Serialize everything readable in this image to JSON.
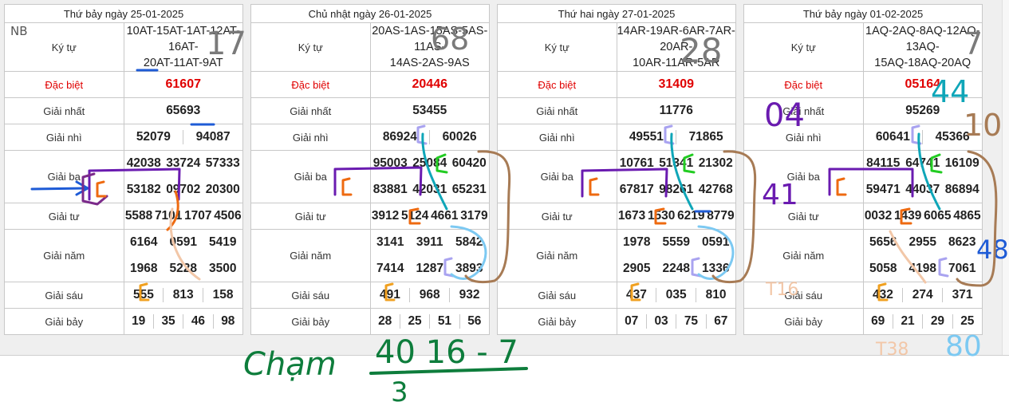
{
  "labels": {
    "kytu": "Ký tự",
    "db": "Đặc biệt",
    "g1": "Giải nhất",
    "g2": "Giải nhì",
    "g3": "Giải ba",
    "g4": "Giải tư",
    "g5": "Giải năm",
    "g6": "Giải sáu",
    "g7": "Giải bảy"
  },
  "tables": [
    {
      "date": "Thứ bảy ngày 25-01-2025",
      "kytu_line1": "10AT-15AT-1AT-12AT-16AT-",
      "kytu_line2": "20AT-11AT-9AT",
      "db": "61607",
      "g1": "65693",
      "g2": [
        "52079",
        "94087"
      ],
      "g3": [
        "42038",
        "33724",
        "57333",
        "53182",
        "09702",
        "20300"
      ],
      "g4": [
        "5588",
        "7101",
        "1707",
        "4506"
      ],
      "g5": [
        "6164",
        "0591",
        "5419",
        "1968",
        "5228",
        "3500"
      ],
      "g6": [
        "555",
        "813",
        "158"
      ],
      "g7": [
        "19",
        "35",
        "46",
        "98"
      ]
    },
    {
      "date": "Chủ nhật ngày 26-01-2025",
      "kytu_line1": "20AS-1AS-15AS-5AS-11AS-",
      "kytu_line2": "14AS-2AS-9AS",
      "db": "20446",
      "g1": "53455",
      "g2": [
        "86924",
        "60026"
      ],
      "g3": [
        "95003",
        "25084",
        "60420",
        "83881",
        "42031",
        "65231"
      ],
      "g4": [
        "3912",
        "5124",
        "4661",
        "3179"
      ],
      "g5": [
        "3141",
        "3911",
        "5842",
        "7414",
        "1287",
        "3893"
      ],
      "g6": [
        "491",
        "968",
        "932"
      ],
      "g7": [
        "28",
        "25",
        "51",
        "56"
      ]
    },
    {
      "date": "Thứ hai ngày 27-01-2025",
      "kytu_line1": "14AR-19AR-6AR-7AR-20AR-",
      "kytu_line2": "10AR-11AR-5AR",
      "db": "31409",
      "g1": "11776",
      "g2": [
        "49551",
        "71865"
      ],
      "g3": [
        "10761",
        "51341",
        "21302",
        "67817",
        "98261",
        "42768"
      ],
      "g4": [
        "1673",
        "1530",
        "6219",
        "8779"
      ],
      "g5": [
        "1978",
        "5559",
        "0591",
        "2905",
        "2248",
        "1336"
      ],
      "g6": [
        "437",
        "035",
        "810"
      ],
      "g7": [
        "07",
        "03",
        "75",
        "67"
      ]
    },
    {
      "date": "Thứ bảy ngày 01-02-2025",
      "kytu_line1": "1AQ-2AQ-8AQ-12AQ-13AQ-",
      "kytu_line2": "15AQ-18AQ-20AQ",
      "db": "05164",
      "g1": "95269",
      "g2": [
        "60641",
        "45366"
      ],
      "g3": [
        "84115",
        "64741",
        "16109",
        "59471",
        "44037",
        "86894"
      ],
      "g4": [
        "0032",
        "1439",
        "6065",
        "4865"
      ],
      "g5": [
        "5656",
        "2955",
        "8623",
        "5058",
        "4198",
        "7061"
      ],
      "g6": [
        "432",
        "274",
        "371"
      ],
      "g7": [
        "69",
        "21",
        "29",
        "25"
      ]
    }
  ],
  "annotations": {
    "n17": "17",
    "n68": "68",
    "n28": "28",
    "n7": "7",
    "n44": "44",
    "n10": "10",
    "n04": "04",
    "n41": "41",
    "n48": "48",
    "n80": "80",
    "nb": "NB",
    "t16": "T16",
    "t38": "T38",
    "cham": "Chạm",
    "formula": "40 16 - 7",
    "denom": "3"
  },
  "colors": {
    "red": "#e00000",
    "purple": "#6a1bb0",
    "blue": "#1e5bd6",
    "green": "#0e7d3c",
    "teal": "#0fa6b8",
    "tan": "#a77b55",
    "orange": "#ee6a10",
    "peach": "#f2c7a8",
    "lightblue": "#7cc9f2",
    "lavender": "#a9a3f0",
    "gray": "#7a7a7a"
  }
}
